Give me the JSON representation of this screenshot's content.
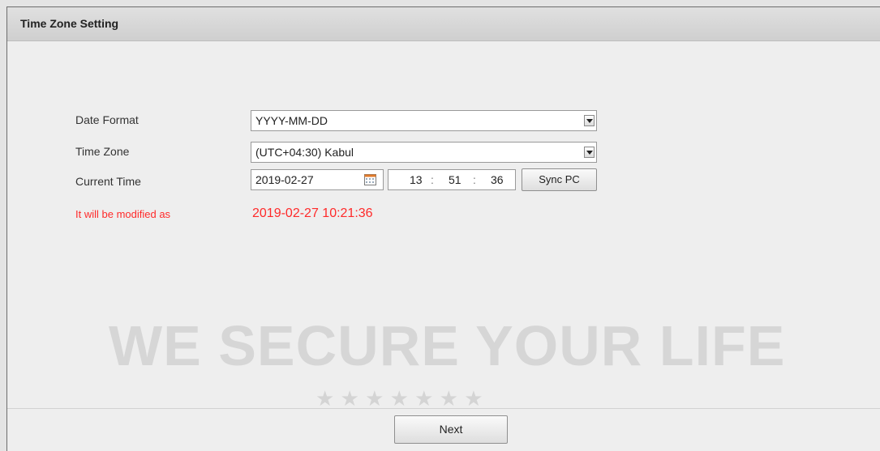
{
  "dialog": {
    "title": "Time Zone Setting"
  },
  "form": {
    "date_format_label": "Date Format",
    "date_format_value": "YYYY-MM-DD",
    "time_zone_label": "Time Zone",
    "time_zone_value": "(UTC+04:30) Kabul",
    "current_time_label": "Current Time",
    "current_date": "2019-02-27",
    "hour": "13",
    "minute": "51",
    "second": "36",
    "time_sep": ":",
    "sync_pc_label": "Sync PC",
    "modified_label": "It will be modified as",
    "modified_value": "2019-02-27 10:21:36"
  },
  "footer": {
    "next_label": "Next"
  },
  "watermark": {
    "slogan": "WE SECURE YOUR LIFE",
    "stars": "★ ★ ★ ★ ★ ★ ★"
  },
  "colors": {
    "warning": "#ff2a2a",
    "background": "#e4e4e4"
  },
  "icons": {
    "dropdown": "chevron-down-icon",
    "calendar": "calendar-icon"
  }
}
